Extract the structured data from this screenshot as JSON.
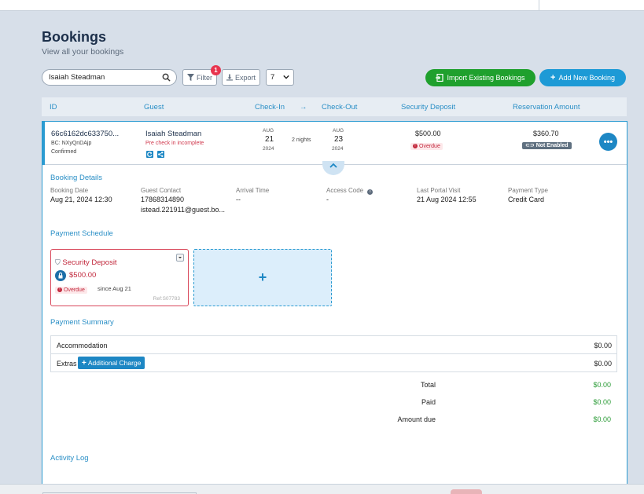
{
  "header": {
    "title": "Bookings",
    "subtitle": "View all your bookings"
  },
  "toolbar": {
    "search_value": "Isaiah Steadman",
    "filter_label": "Filter",
    "filter_badge": "1",
    "export_label": "Export",
    "page_size": "7",
    "import_label": "Import Existing Bookings",
    "add_label": "Add New Booking"
  },
  "table_headers": {
    "id": "ID",
    "guest": "Guest",
    "check_in": "Check-In",
    "arrow": "→",
    "check_out": "Check-Out",
    "security_deposit": "Security Deposit",
    "reservation_amount": "Reservation Amount"
  },
  "booking": {
    "id": "66c6162dc633750...",
    "bc": "BC: NXyQnDAjp",
    "status": "Confirmed",
    "guest_name": "Isaiah Steadman",
    "precheck": "Pre check in incomplete",
    "checkin_month": "AUG",
    "checkin_day": "21",
    "checkin_year": "2024",
    "nights": "2 nights",
    "checkout_month": "AUG",
    "checkout_day": "23",
    "checkout_year": "2024",
    "deposit_amount": "$500.00",
    "deposit_status": "Overdue",
    "reservation_amount": "$360.70",
    "reservation_status": "Not Enabled"
  },
  "details": {
    "section_title": "Booking Details",
    "booking_date_label": "Booking Date",
    "booking_date": "Aug 21, 2024 12:30",
    "guest_contact_label": "Guest Contact",
    "guest_phone": "17868314890",
    "guest_email": "istead.221911@guest.bo...",
    "arrival_label": "Arrival Time",
    "arrival_value": "--",
    "access_label": "Access Code",
    "access_value": "-",
    "portal_label": "Last Portal Visit",
    "portal_value": "21 Aug 2024 12:55",
    "payment_type_label": "Payment Type",
    "payment_type_value": "Credit Card"
  },
  "schedule": {
    "section_title": "Payment Schedule",
    "card_title": "Security Deposit",
    "card_amount": "$500.00",
    "card_status": "Overdue",
    "card_since": "since Aug 21",
    "card_ref": "Ref:S07783",
    "add_symbol": "+"
  },
  "summary": {
    "section_title": "Payment Summary",
    "accommodation_label": "Accommodation",
    "accommodation_value": "$0.00",
    "extras_label": "Extras",
    "additional_charge_label": "Additional Charge",
    "extras_value": "$0.00",
    "total_label": "Total",
    "total_value": "$0.00",
    "paid_label": "Paid",
    "paid_value": "$0.00",
    "due_label": "Amount due",
    "due_value": "$0.00"
  },
  "activity": {
    "section_title": "Activity Log"
  },
  "colors": {
    "accent_blue": "#1d9ad6",
    "green": "#1fa02d",
    "overdue_red": "#c2293d"
  }
}
